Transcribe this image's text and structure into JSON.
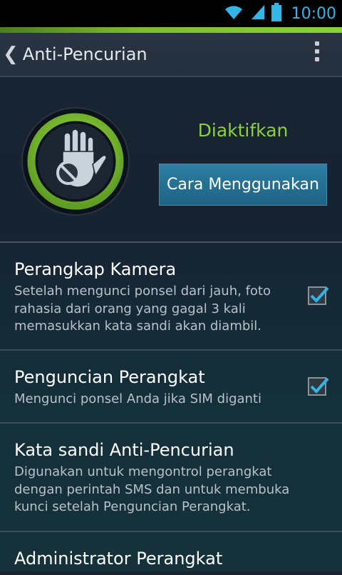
{
  "status_bar": {
    "time": "10:00"
  },
  "action_bar": {
    "title": "Anti-Pencurian"
  },
  "hero": {
    "status": "Diaktifkan",
    "button_label": "Cara Menggunakan"
  },
  "settings": [
    {
      "title": "Perangkap Kamera",
      "description": "Setelah mengunci ponsel dari jauh, foto rahasia dari orang yang gagal 3 kali memasukkan kata sandi akan diambil.",
      "checked": true
    },
    {
      "title": "Penguncian Perangkat",
      "description": "Mengunci ponsel Anda jika SIM diganti",
      "checked": true
    },
    {
      "title": "Kata sandi Anti-Pencurian",
      "description": "Digunakan untuk mengontrol perangkat dengan perintah SMS dan untuk membuka kunci setelah Penguncian Perangkat."
    },
    {
      "title": "Administrator Perangkat"
    }
  ],
  "icons": {
    "wifi": "wifi-icon",
    "signal": "signal-icon",
    "battery": "battery-icon",
    "back": "chevron-left-icon",
    "overflow": "overflow-menu-icon",
    "badge": "hand-stop-icon",
    "check": "checkmark-icon"
  },
  "colors": {
    "accent_green": "#8bd13a",
    "button_blue": "#2575a0",
    "status_blue": "#33b5e5"
  }
}
